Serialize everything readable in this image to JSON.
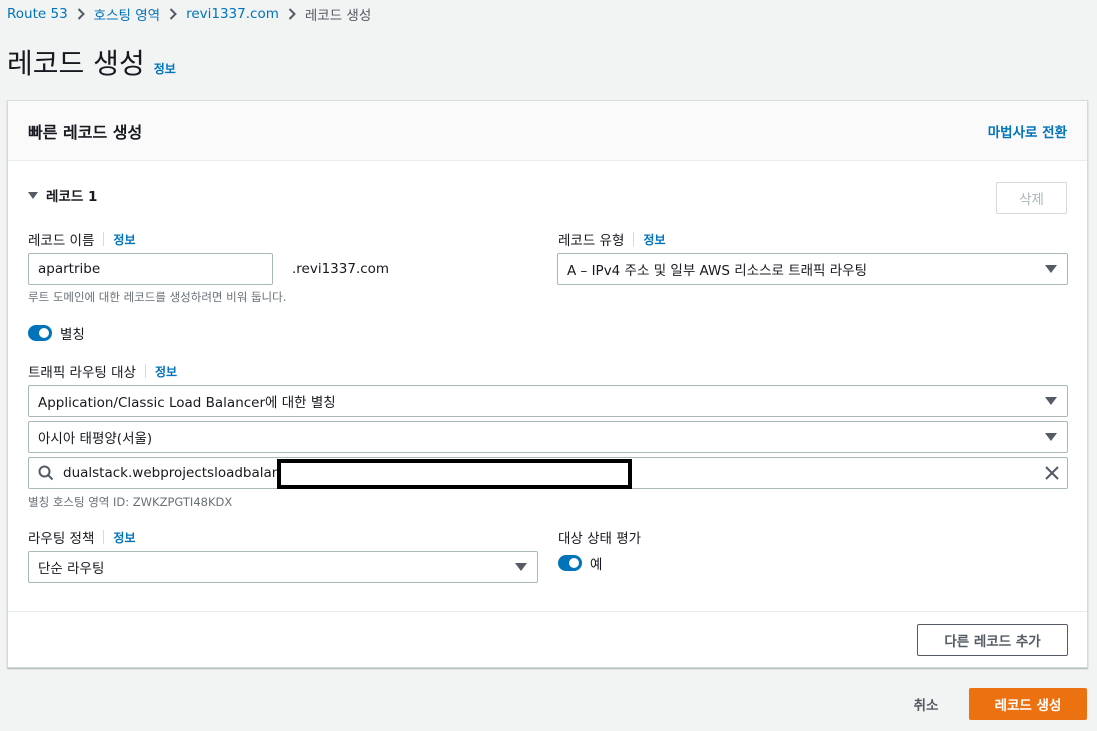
{
  "breadcrumb": {
    "items": [
      "Route 53",
      "호스팅 영역",
      "revi1337.com"
    ],
    "current": "레코드 생성"
  },
  "page": {
    "title": "레코드 생성",
    "info": "정보"
  },
  "card": {
    "title": "빠른 레코드 생성",
    "wizard_link": "마법사로 전환",
    "record_section": "레코드 1",
    "delete_label": "삭제",
    "record_name": {
      "label": "레코드 이름",
      "info": "정보",
      "value": "apartribe",
      "suffix": ".revi1337.com",
      "hint": "루트 도메인에 대한 레코드를 생성하려면 비워 둡니다."
    },
    "record_type": {
      "label": "레코드 유형",
      "info": "정보",
      "value": "A – IPv4 주소 및 일부 AWS 리소스로 트래픽 라우팅"
    },
    "alias": {
      "label": "별칭",
      "enabled": true
    },
    "route_target": {
      "label": "트래픽 라우팅 대상",
      "info": "정보",
      "endpoint_type": "Application/Classic Load Balancer에 대한 별칭",
      "region": "아시아 태평양(서울)",
      "search_value": "dualstack.webprojectsloadbalance",
      "hosted_zone_hint": "별칭 호스팅 영역 ID: ZWKZPGTI48KDX"
    },
    "routing_policy": {
      "label": "라우팅 정책",
      "info": "정보",
      "value": "단순 라우팅"
    },
    "health_eval": {
      "label": "대상 상태 평가",
      "toggle_label": "예",
      "enabled": true
    },
    "add_record_label": "다른 레코드 추가"
  },
  "actions": {
    "cancel": "취소",
    "create": "레코드 생성"
  },
  "colors": {
    "link": "#0073bb",
    "primary": "#ec7211",
    "toggle": "#0073bb",
    "background": "#f2f3f3"
  },
  "icons": [
    "chevron-right-icon",
    "caret-down-icon",
    "search-icon",
    "clear-icon",
    "triangle-expand-icon"
  ]
}
